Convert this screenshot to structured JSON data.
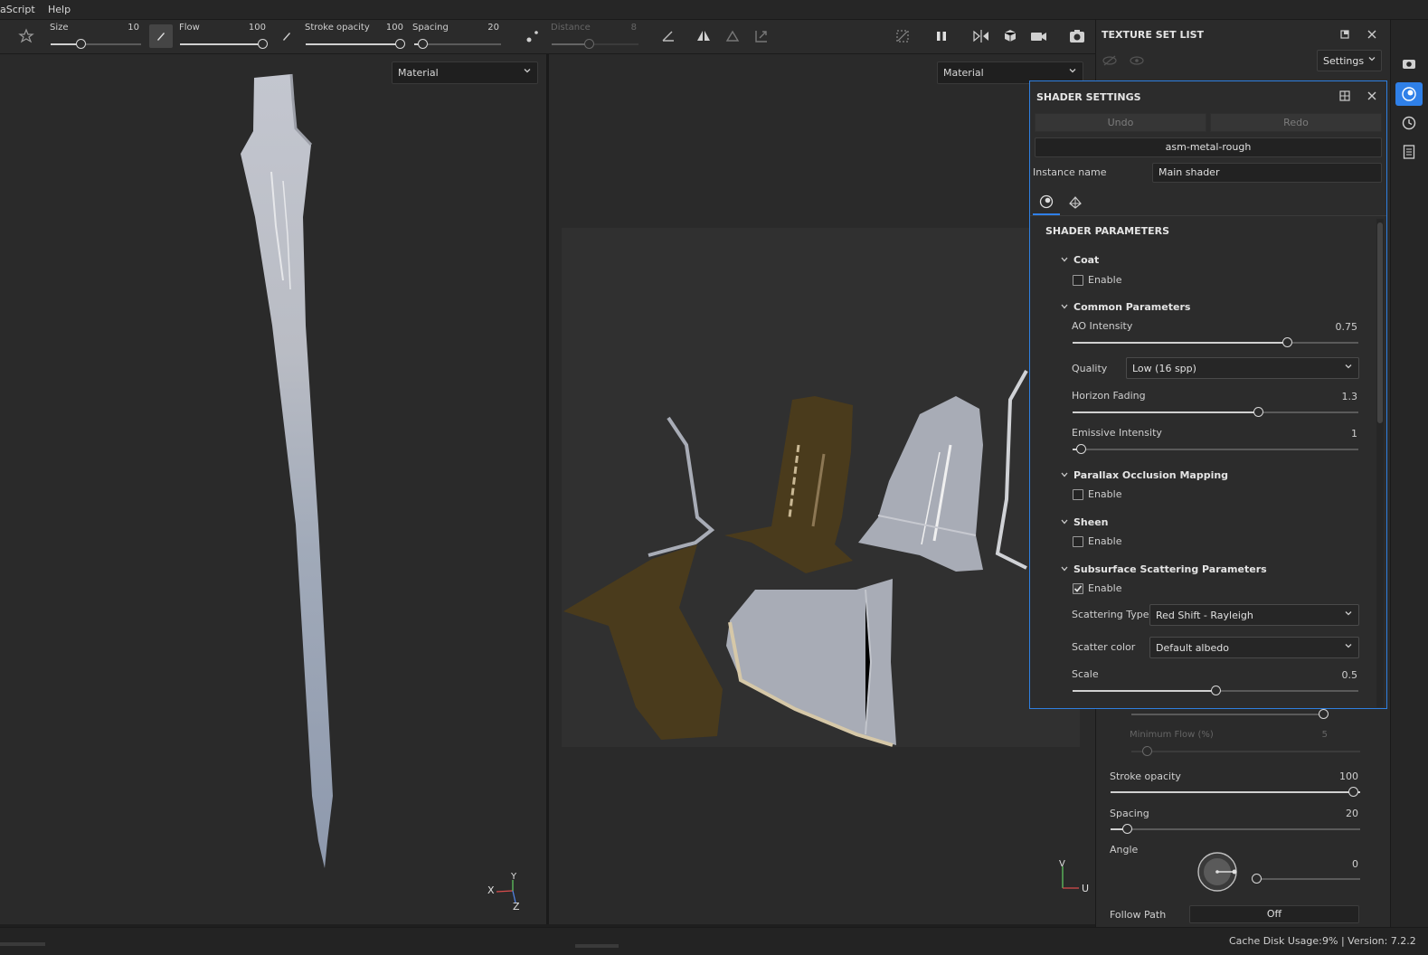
{
  "menu": {
    "item_script": "aScript",
    "item_help": "Help"
  },
  "toolbar": {
    "size_label": "Size",
    "size_value": "10",
    "flow_label": "Flow",
    "flow_value": "100",
    "stroke_opacity_label": "Stroke opacity",
    "stroke_opacity_value": "100",
    "spacing_label": "Spacing",
    "spacing_value": "20",
    "distance_label": "Distance",
    "distance_value": "8"
  },
  "viewport_left": {
    "mode": "Material"
  },
  "viewport_right": {
    "mode": "Material"
  },
  "texture_set_list": {
    "title": "TEXTURE SET LIST",
    "settings_label": "Settings"
  },
  "shader_settings": {
    "title": "SHADER SETTINGS",
    "undo": "Undo",
    "redo": "Redo",
    "shader_name": "asm-metal-rough",
    "instance_label": "Instance name",
    "instance_value": "Main shader",
    "params_title": "SHADER PARAMETERS",
    "coat": {
      "title": "Coat",
      "enable_label": "Enable",
      "enabled": false
    },
    "common": {
      "title": "Common Parameters",
      "ao_label": "AO Intensity",
      "ao_value": "0.75",
      "ao_fraction": 0.75,
      "quality_label": "Quality",
      "quality_value": "Low (16 spp)",
      "horizon_label": "Horizon Fading",
      "horizon_value": "1.3",
      "horizon_fraction": 0.65,
      "emissive_label": "Emissive Intensity",
      "emissive_value": "1",
      "emissive_fraction": 0.03
    },
    "parallax": {
      "title": "Parallax Occlusion Mapping",
      "enable_label": "Enable",
      "enabled": false
    },
    "sheen": {
      "title": "Sheen",
      "enable_label": "Enable",
      "enabled": false
    },
    "subsurface": {
      "title": "Subsurface Scattering Parameters",
      "enable_label": "Enable",
      "enabled": true,
      "type_label": "Scattering Type",
      "type_value": "Red Shift - Rayleigh",
      "color_label": "Scatter color",
      "color_value": "Default albedo",
      "scale_label": "Scale",
      "scale_value": "0.5",
      "scale_fraction": 0.5
    }
  },
  "brush_props": {
    "min_flow_label": "Minimum Flow (%)",
    "min_flow_value": "5",
    "stroke_opacity_label": "Stroke opacity",
    "stroke_opacity_value": "100",
    "spacing_label": "Spacing",
    "spacing_value": "20",
    "angle_label": "Angle",
    "angle_value": "0",
    "follow_path_label": "Follow Path",
    "follow_path_value": "Off"
  },
  "axes": {
    "left_x": "X",
    "left_y": "Y",
    "left_z": "Z",
    "right_v": "V",
    "right_u": "U"
  },
  "status": {
    "cache_label": "Cache Disk Usage:",
    "cache_value": "9% | Version: 7.2.2"
  },
  "colors": {
    "accent": "#2f80e8",
    "panel": "#2b2b2b",
    "viewport": "#2a2a2a",
    "uv_bg": "#303030",
    "island_brown": "#4a3b1c",
    "island_grey": "#a8acb6"
  }
}
